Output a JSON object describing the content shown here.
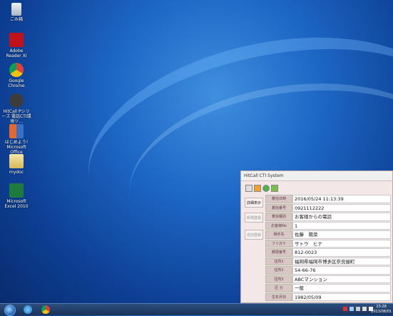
{
  "desktop": {
    "icons": [
      {
        "name": "recycle-bin-icon",
        "label": "ごみ箱",
        "color": "#cfd8e3"
      },
      {
        "name": "adobe-reader-icon",
        "label": "Adobe Reader XI",
        "color": "#c1121b"
      },
      {
        "name": "chrome-icon",
        "label": "Google Chrome",
        "color": "#e0443a"
      },
      {
        "name": "hitcall-icon",
        "label": "HitCall Pシリーズ 電話CTI環境ツ...",
        "color": "#4a4a4a"
      },
      {
        "name": "office-icon",
        "label": "はじめよう! Microsoft Office",
        "color": "#e2682d"
      },
      {
        "name": "folder-icon",
        "label": "mydoc",
        "color": "#e8d48a"
      },
      {
        "name": "excel-icon",
        "label": "Microsoft Excel 2010",
        "color": "#1f7a3d"
      }
    ]
  },
  "window": {
    "title": "HitCall CTI System",
    "side_buttons": [
      "詳細表示",
      "新規登録",
      "追加登録"
    ],
    "rows": [
      {
        "label": "着信日時",
        "value": "2016/05/24 11:13:39"
      },
      {
        "label": "着信番号",
        "value": "0921112222"
      },
      {
        "label": "着信種別",
        "value": "お客様からの電話"
      },
      {
        "label": "お客様No",
        "value": "1"
      },
      {
        "label": "相手先",
        "value": "佐藤　陽菜"
      },
      {
        "label": "フリガナ",
        "value": "サトウ　ヒナ"
      },
      {
        "label": "郵便番号",
        "value": "812-0023"
      },
      {
        "label": "住所1",
        "value": "福岡県福岡市博多区奈良屋町"
      },
      {
        "label": "住所2",
        "value": "54-66-76"
      },
      {
        "label": "住所3",
        "value": "ABCマンション"
      },
      {
        "label": "区 分",
        "value": "一般"
      },
      {
        "label": "生年月日",
        "value": "1982/05/09"
      }
    ]
  },
  "taskbar": {
    "clock_time": "23:28",
    "clock_date": "2013/08/01"
  }
}
